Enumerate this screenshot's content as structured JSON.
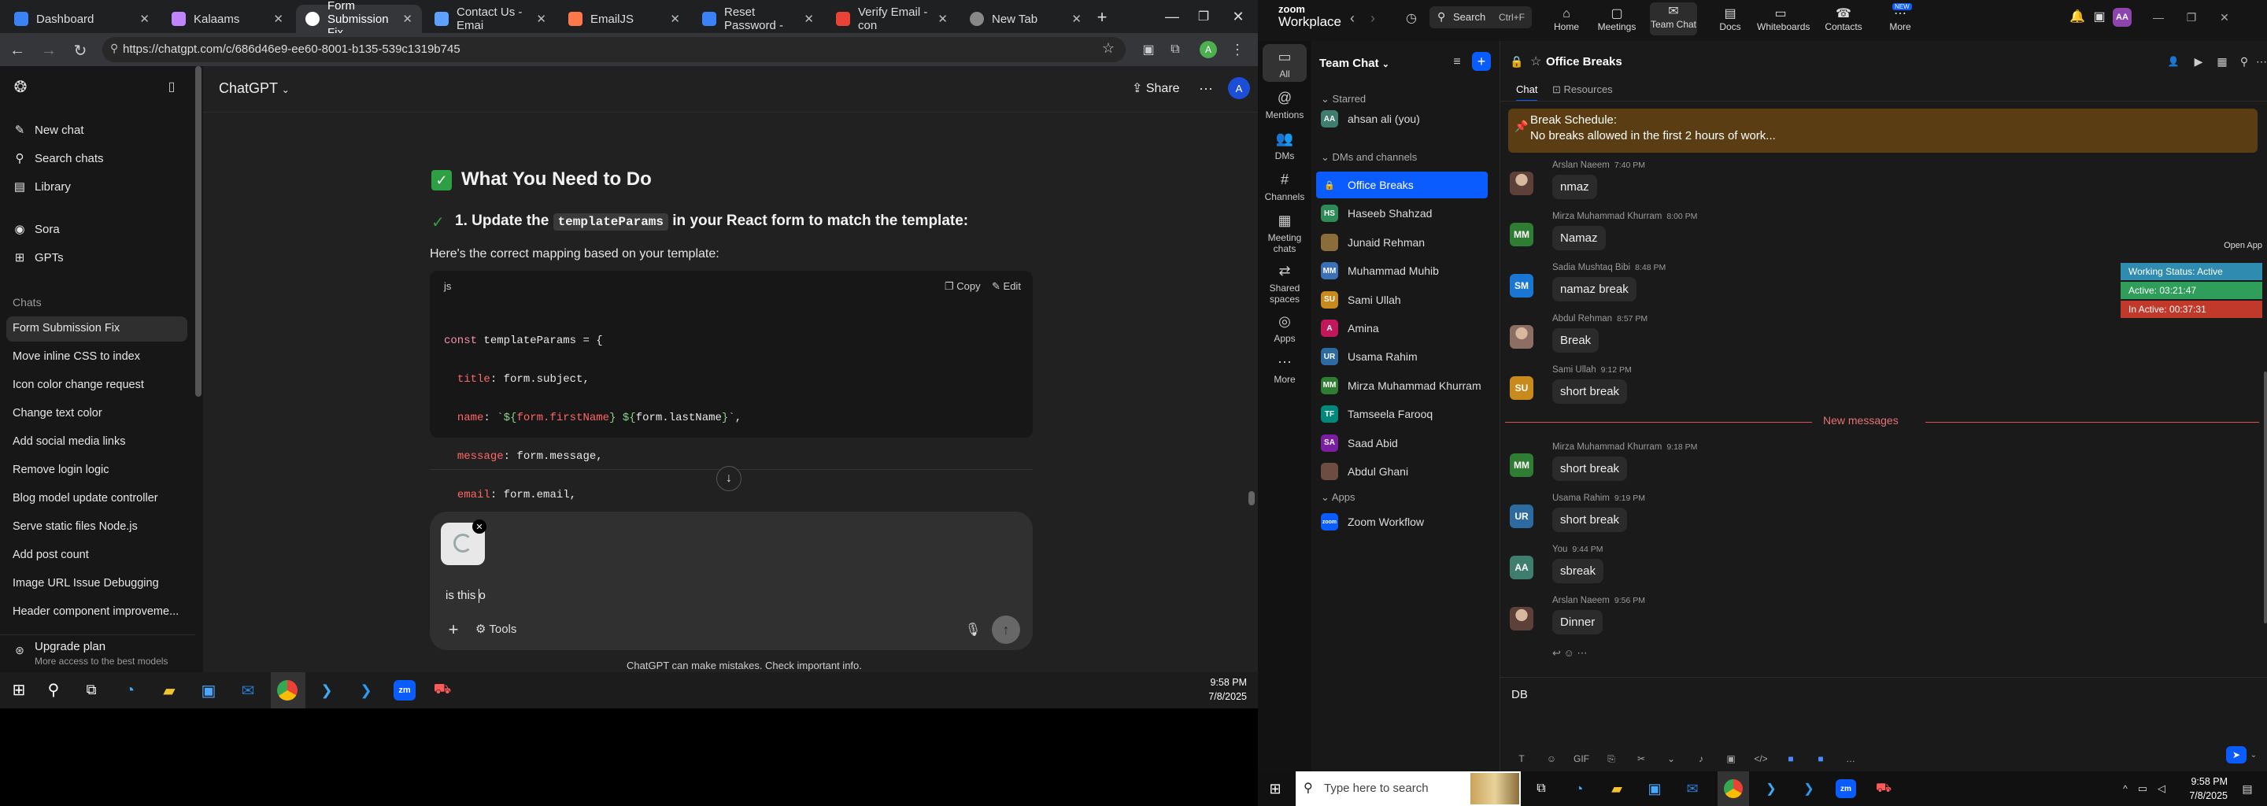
{
  "browser": {
    "tabs": [
      {
        "label": "Dashboard",
        "color": "#3b82f6"
      },
      {
        "label": "Kalaams",
        "color": "#c084fc"
      },
      {
        "label": "Form Submission Fix",
        "color": "#fff"
      },
      {
        "label": "Contact Us - Emai",
        "color": "#5ea0ff"
      },
      {
        "label": "EmailJS",
        "color": "#ff7849"
      },
      {
        "label": "Reset Password -",
        "color": "#3b82f6"
      },
      {
        "label": "Verify Email - con",
        "color": "#ea4335"
      },
      {
        "label": "New Tab",
        "color": "#888"
      }
    ],
    "url": "https://chatgpt.com/c/686d46e9-ee60-8001-b135-539c1319b745",
    "profile_initial": "A"
  },
  "chatgpt": {
    "sidebar": {
      "new_chat": "New chat",
      "search": "Search chats",
      "library": "Library",
      "sora": "Sora",
      "gpts": "GPTs",
      "chats_heading": "Chats",
      "chats": [
        "Form Submission Fix",
        "Move inline CSS to index",
        "Icon color change request",
        "Change text color",
        "Add social media links",
        "Remove login logic",
        "Blog model update controller",
        "Serve static files Node.js",
        "Add post count",
        "Image URL Issue Debugging",
        "Header component improveme..."
      ],
      "upgrade_title": "Upgrade plan",
      "upgrade_sub": "More access to the best models"
    },
    "header": {
      "title": "ChatGPT",
      "share": "Share",
      "avatar": "A"
    },
    "content": {
      "heading": "What You Need to Do",
      "step_prefix": "1. Update the ",
      "step_code": "templateParams",
      "step_suffix": " in your React form to match the template:",
      "para": "Here's the correct mapping based on your template:",
      "code_lang": "js",
      "copy": "Copy",
      "edit": "Edit",
      "code": {
        "l1_kw": "const",
        "l1_var": " templateParams = {",
        "l2_prop": "title",
        "l2_val": ": form.subject,",
        "l3_prop": "name",
        "l3_colon": ": ",
        "l3_str1": "`${",
        "l3_inner1": "form.firstName",
        "l3_str2": "} ${",
        "l3_inner2": "form.lastName",
        "l3_str3": "}`",
        "l3_comma": ",",
        "l4_prop": "message",
        "l4_val": ": form.message,",
        "l5_prop": "email",
        "l5_val": ": form.email,",
        "l6": "};"
      }
    },
    "composer": {
      "input_value": "is this o",
      "tools": "Tools"
    },
    "disclaimer": "ChatGPT can make mistakes. Check important info."
  },
  "taskbar_left": {
    "time": "9:58 PM",
    "date": "7/8/2025"
  },
  "zoom": {
    "brand": "zoom",
    "brand_sub": "Workplace",
    "search": "Search",
    "search_shortcut": "Ctrl+F",
    "nav": [
      {
        "label": "Home",
        "badge": ""
      },
      {
        "label": "Meetings",
        "badge": ""
      },
      {
        "label": "Team Chat",
        "badge": ""
      },
      {
        "label": "Docs",
        "badge": ""
      },
      {
        "label": "Whiteboards",
        "badge": ""
      },
      {
        "label": "Contacts",
        "badge": ""
      },
      {
        "label": "More",
        "badge": "NEW"
      }
    ],
    "leftnav": [
      "All",
      "Mentions",
      "DMs",
      "Channels",
      "Meeting chats",
      "Shared spaces",
      "Apps",
      "More"
    ],
    "panel_title": "Team Chat",
    "starred": "Starred",
    "starred_items": [
      {
        "initials": "AA",
        "name": "ahsan ali (you)",
        "color": "#3f7d6e"
      }
    ],
    "dms_heading": "DMs and channels",
    "channels": [
      {
        "initials": "",
        "name": "Office Breaks",
        "color": "#0b5cff"
      },
      {
        "initials": "HS",
        "name": "Haseeb Shahzad",
        "color": "#2e8b57"
      },
      {
        "initials": "",
        "name": "Junaid Rehman",
        "color": "#8a6d3b"
      },
      {
        "initials": "MM",
        "name": "Muhammad Muhib",
        "color": "#3b6fb6"
      },
      {
        "initials": "SU",
        "name": "Sami Ullah",
        "color": "#c98a1d"
      },
      {
        "initials": "A",
        "name": "Amina",
        "color": "#c2185b"
      },
      {
        "initials": "UR",
        "name": "Usama Rahim",
        "color": "#2c6aa0"
      },
      {
        "initials": "MM",
        "name": "Mirza Muhammad Khurram",
        "color": "#2e7d32"
      },
      {
        "initials": "TF",
        "name": "Tamseela Farooq",
        "color": "#00897b"
      },
      {
        "initials": "SA",
        "name": "Saad Abid",
        "color": "#7b1fa2"
      },
      {
        "initials": "",
        "name": "Abdul Ghani",
        "color": "#6d4c41"
      }
    ],
    "apps_heading": "Apps",
    "apps": [
      {
        "name": "Zoom Workflow",
        "initials": "zoom"
      }
    ],
    "channel": {
      "title": "Office Breaks",
      "tab_chat": "Chat",
      "tab_resources": "Resources"
    },
    "pinned": {
      "title": "Break Schedule:",
      "body": "No breaks allowed in the first 2 hours of work..."
    },
    "messages_top": [
      {
        "sender": "Arslan Naeem",
        "time": "7:40 PM",
        "text": "nmaz",
        "initials": "",
        "color": "#5d4037"
      },
      {
        "sender": "Mirza Muhammad Khurram",
        "time": "8:00 PM",
        "text": "Namaz",
        "initials": "MM",
        "color": "#2e7d32"
      },
      {
        "sender": "Sadia Mushtaq Bibi",
        "time": "8:48 PM",
        "text": "namaz  break",
        "initials": "SM",
        "color": "#1976d2"
      },
      {
        "sender": "Abdul Rehman",
        "time": "8:57 PM",
        "text": "Break",
        "initials": "",
        "color": "#8d6e63"
      },
      {
        "sender": "Sami Ullah",
        "time": "9:12 PM",
        "text": "short break",
        "initials": "SU",
        "color": "#c98a1d"
      }
    ],
    "new_messages": "New messages",
    "messages_new": [
      {
        "sender": "Mirza Muhammad Khurram",
        "time": "9:18 PM",
        "text": "short break",
        "initials": "MM",
        "color": "#2e7d32"
      },
      {
        "sender": "Usama Rahim",
        "time": "9:19 PM",
        "text": "short break",
        "initials": "UR",
        "color": "#2c6aa0"
      },
      {
        "sender": "You",
        "time": "9:44 PM",
        "text": "sbreak",
        "initials": "AA",
        "color": "#3f7d6e"
      },
      {
        "sender": "Arslan Naeem",
        "time": "9:56 PM",
        "text": "Dinner",
        "initials": "",
        "color": "#5d4037"
      }
    ],
    "open_app": "Open App",
    "status": {
      "working": "Working Status: Active",
      "active": "Active: 03:21:47",
      "inactive": "In Active: 00:37:31"
    },
    "composer_value": "DB",
    "composer_tools": [
      "T",
      "☺",
      "GIF",
      "⎘",
      "✂",
      "⌄",
      "♪",
      "▣",
      "</>",
      "■",
      "■",
      "…"
    ]
  },
  "taskbar_right": {
    "search_placeholder": "Type here to search",
    "time": "9:58 PM",
    "date": "7/8/2025"
  }
}
